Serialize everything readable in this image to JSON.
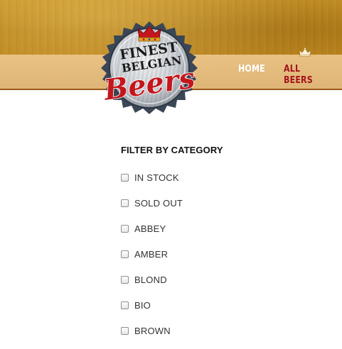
{
  "logo": {
    "line1": "FINEST",
    "line2": "BELGIAN",
    "line3": "Beers"
  },
  "nav": {
    "items": [
      {
        "label": "HOME",
        "active": false
      },
      {
        "label": "ALL BEERS",
        "active": true
      }
    ]
  },
  "filter": {
    "title": "FILTER BY CATEGORY",
    "options": [
      {
        "label": "IN STOCK",
        "checked": false
      },
      {
        "label": "SOLD OUT",
        "checked": false
      },
      {
        "label": "ABBEY",
        "checked": false
      },
      {
        "label": "AMBER",
        "checked": false
      },
      {
        "label": "BLOND",
        "checked": false
      },
      {
        "label": "BIO",
        "checked": false
      },
      {
        "label": "BROWN",
        "checked": false
      }
    ]
  },
  "colors": {
    "accent_red": "#a4141c",
    "header_gold": "#c08a22",
    "nav_band": "#e8c08a"
  },
  "icons": {
    "crown": "crown-icon",
    "checkbox": "checkbox-icon"
  }
}
